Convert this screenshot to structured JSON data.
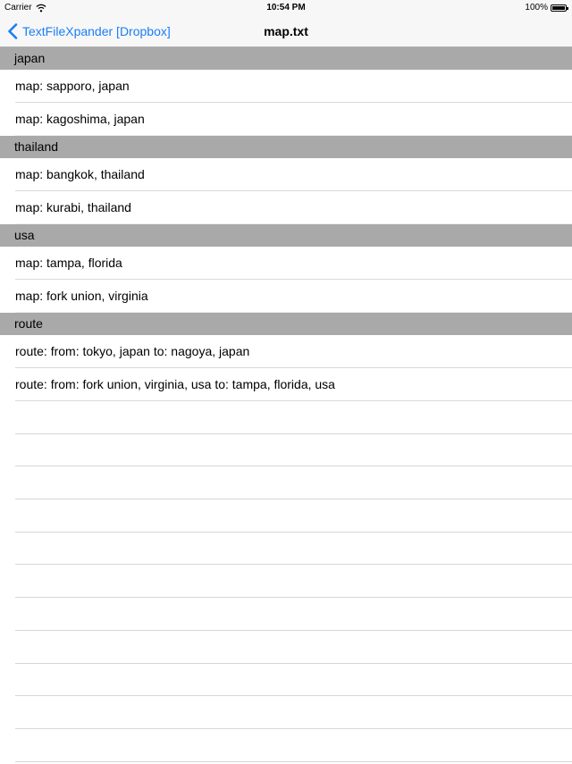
{
  "status_bar": {
    "carrier": "Carrier",
    "time": "10:54 PM",
    "battery": "100%"
  },
  "nav": {
    "back_label": "TextFileXpander [Dropbox]",
    "title": "map.txt"
  },
  "sections": [
    {
      "header": "japan",
      "rows": [
        "map: sapporo, japan",
        "map: kagoshima, japan"
      ]
    },
    {
      "header": "thailand",
      "rows": [
        "map: bangkok, thailand",
        "map: kurabi, thailand"
      ]
    },
    {
      "header": "usa",
      "rows": [
        "map: tampa, florida",
        "map: fork union, virginia"
      ]
    },
    {
      "header": "route",
      "rows": [
        "route: from: tokyo, japan to: nagoya, japan",
        "route: from: fork union, virginia, usa to: tampa, florida, usa"
      ]
    }
  ],
  "colors": {
    "accent": "#1a7ef7",
    "section_header_bg": "#a9a9a9",
    "bar_bg": "#f7f7f7"
  },
  "icons": {
    "wifi": "wifi-icon",
    "battery": "battery-icon",
    "back": "chevron-left-icon"
  }
}
